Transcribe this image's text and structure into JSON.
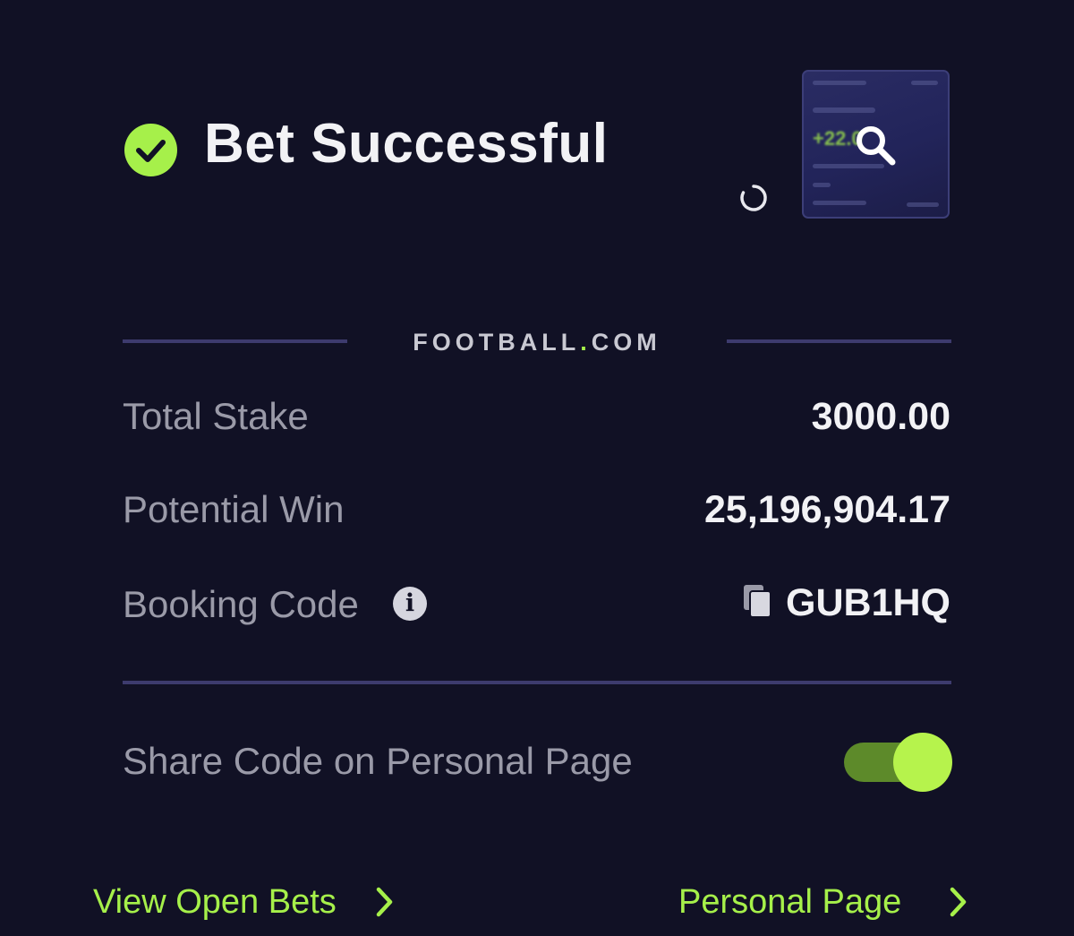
{
  "header": {
    "title": "Bet Successful",
    "status_icon": "check-circle-icon",
    "loading_icon": "spinner-icon",
    "preview": {
      "zoom_icon": "magnifier-icon",
      "amount_hint": "+22.0"
    }
  },
  "brand": {
    "name_part1": "FOOTBALL",
    "dot": ".",
    "name_part2": "COM"
  },
  "summary": {
    "total_stake_label": "Total Stake",
    "total_stake_value": "3000.00",
    "potential_win_label": "Potential Win",
    "potential_win_value": "25,196,904.17",
    "booking_code_label": "Booking Code",
    "booking_code_value": "GUB1HQ",
    "info_icon": "i"
  },
  "share": {
    "label": "Share Code on Personal Page",
    "enabled": true
  },
  "footer": {
    "view_open_bets": "View Open Bets",
    "personal_page": "Personal Page"
  },
  "colors": {
    "background": "#111125",
    "accent": "#a6f04a",
    "divider": "#3d3b6e",
    "muted_text": "#9a9aa8"
  }
}
